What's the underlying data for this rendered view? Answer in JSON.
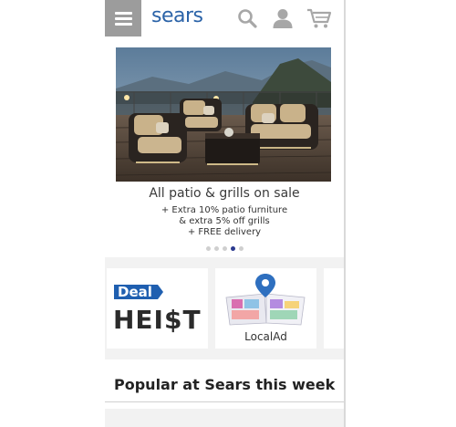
{
  "header": {
    "logo": "sears",
    "menu_icon": "hamburger-menu-icon",
    "search_icon": "search-icon",
    "account_icon": "user-icon",
    "cart_icon": "cart-icon",
    "brand_color": "#2b63a8"
  },
  "hero": {
    "title": "All patio & grills on sale",
    "lines": [
      "+ Extra 10% patio furniture",
      "& extra 5% off grills",
      "+ FREE delivery"
    ],
    "carousel": {
      "slide_count": 5,
      "active_slide": 4
    }
  },
  "cards": [
    {
      "logo_text_top": "Deal",
      "logo_text_bottom": "HEI$T",
      "label": ""
    },
    {
      "label": "LocalAd"
    }
  ],
  "popular": {
    "title": "Popular at Sears this week"
  }
}
